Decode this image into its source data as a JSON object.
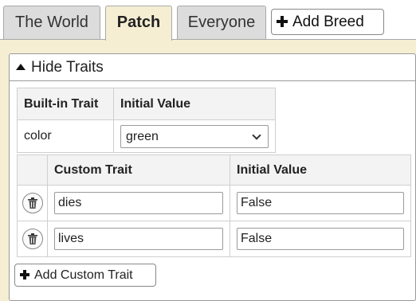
{
  "tabs": [
    {
      "label": "The World"
    },
    {
      "label": "Patch"
    },
    {
      "label": "Everyone"
    }
  ],
  "active_tab": "Patch",
  "add_breed_label": "Add Breed",
  "traits_section": {
    "toggle_label": "Hide Traits",
    "builtin_table": {
      "headers": [
        "Built-in Trait",
        "Initial Value"
      ],
      "rows": [
        {
          "trait": "color",
          "value": "green"
        }
      ]
    },
    "custom_table": {
      "headers": [
        "Custom Trait",
        "Initial Value"
      ],
      "rows": [
        {
          "trait": "dies",
          "value": "False"
        },
        {
          "trait": "lives",
          "value": "False"
        }
      ]
    },
    "add_custom_label": "Add Custom Trait"
  },
  "colors": {
    "panel_bg": "#f5eed3",
    "tab_inactive_bg": "#dcdcdc",
    "header_bg": "#f3f3f3"
  },
  "icons": [
    "plus-icon",
    "triangle-up-icon",
    "chevron-down-icon",
    "trash-icon"
  ]
}
